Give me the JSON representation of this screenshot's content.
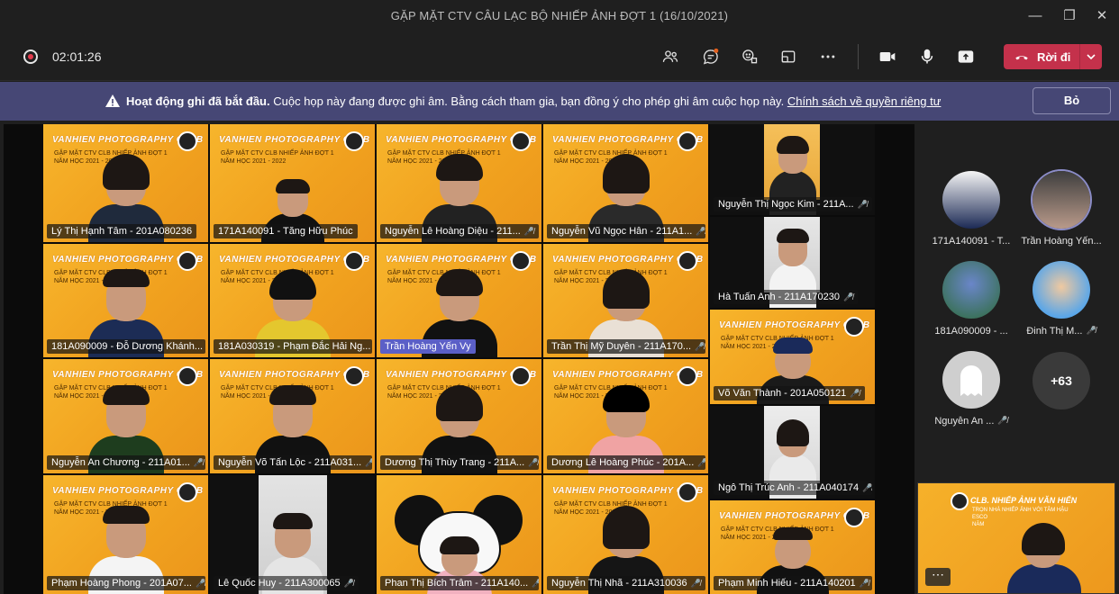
{
  "window": {
    "title": "GẶP MẶT CTV CÂU LẠC BỘ NHIẾP ẢNH ĐỢT 1 (16/10/2021)"
  },
  "toolbar": {
    "timer": "02:01:26",
    "leave_label": "Rời đi",
    "icons": [
      "people-icon",
      "chat-icon",
      "reactions-icon",
      "rooms-icon",
      "more-icon",
      "camera-icon",
      "mic-icon",
      "share-icon"
    ]
  },
  "banner": {
    "title": "Hoạt động ghi đã bắt đầu.",
    "message": "Cuộc họp này đang được ghi âm. Bằng cách tham gia, bạn đồng ý cho phép ghi âm cuộc họp này.",
    "link": "Chính sách về quyền riêng tư",
    "dismiss_label": "Bỏ"
  },
  "tile_brand": {
    "title": "VANHIEN PHOTOGRAPHY CLUB",
    "line1": "GẶP MẶT CTV CLB NHIẾP ẢNH ĐỢT 1",
    "line2": "NĂM HỌC 2021 - 2022"
  },
  "participants": [
    {
      "name": "Lý Thị Hạnh Tâm - 201A080236",
      "muted": false
    },
    {
      "name": "171A140091 - Tăng Hữu Phúc",
      "muted": false
    },
    {
      "name": "Nguyễn Lê Hoàng Diệu - 211...",
      "muted": true
    },
    {
      "name": "Nguyễn Vũ Ngọc Hân - 211A1...",
      "muted": true
    },
    {
      "name": "Nguyễn Thị Ngọc Kim - 211A...",
      "muted": true
    },
    {
      "name": "181A090009 - Đỗ Dương Khánh...",
      "muted": false
    },
    {
      "name": "181A030319 - Phạm Đắc Hải Ng...",
      "muted": false
    },
    {
      "name": "Trần Hoàng Yến Vy",
      "muted": false,
      "speaking": true
    },
    {
      "name": "Trần Thị Mỹ Duyên - 211A170...",
      "muted": true
    },
    {
      "name": "Hà Tuấn Anh - 211A170230",
      "muted": true
    },
    {
      "name": "Võ Văn Thành - 201A050121",
      "muted": true
    },
    {
      "name": "Nguyễn An Chương - 211A01...",
      "muted": true
    },
    {
      "name": "Nguyễn Võ Tấn Lộc - 211A031...",
      "muted": true
    },
    {
      "name": "Dương  Thị Thùy Trang - 211A...",
      "muted": true
    },
    {
      "name": "Dương Lê Hoàng Phúc - 201A...",
      "muted": true
    },
    {
      "name": "Ngô Thị Trúc Anh - 211A040174",
      "muted": true
    },
    {
      "name": "Phạm Hoàng Phong - 201A07...",
      "muted": true
    },
    {
      "name": "Lê Quốc Huy - 211A300065",
      "muted": true
    },
    {
      "name": "Phan Thị Bích Trâm - 211A140...",
      "muted": true
    },
    {
      "name": "Nguyễn Thị Nhã - 211A310036",
      "muted": true
    },
    {
      "name": "Phạm Minh Hiếu - 211A140201",
      "muted": true
    }
  ],
  "sidebar": {
    "people": [
      {
        "name": "171A140091 - T...",
        "muted": false
      },
      {
        "name": "Trần Hoàng Yến...",
        "muted": false
      },
      {
        "name": "181A090009 - ...",
        "muted": false
      },
      {
        "name": "Đinh Thị M...",
        "muted": true
      },
      {
        "name": "Nguyễn An ...",
        "muted": true
      }
    ],
    "overflow_count": "+63"
  },
  "selfview": {
    "brand": "CLB. NHIẾP ẢNH VĂN HIẾN",
    "line1": "TRỌN NHÀ NHIẾP ẢNH VỚI TÂM HẬU",
    "line2": "ESCO",
    "line3": "NĂM"
  }
}
